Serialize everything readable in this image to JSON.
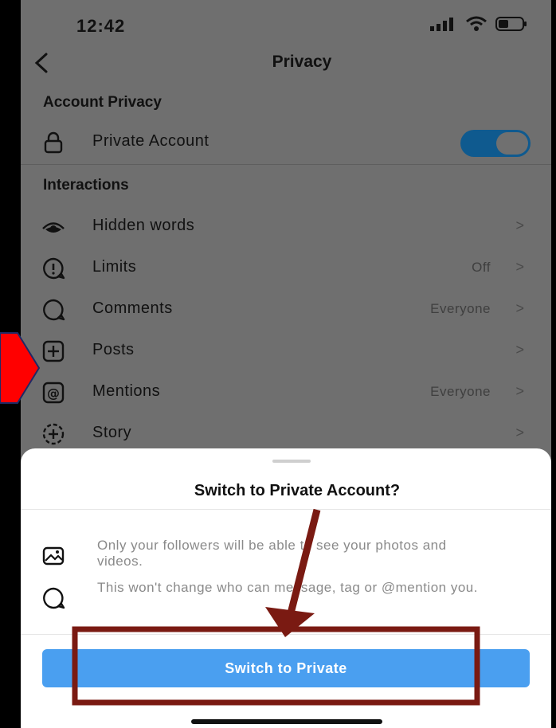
{
  "status_bar": {
    "time": "12:42"
  },
  "nav": {
    "title": "Privacy"
  },
  "account_privacy": {
    "section_title": "Account Privacy",
    "private_account_label": "Private Account",
    "private_account_on": true
  },
  "interactions": {
    "section_title": "Interactions",
    "items": [
      {
        "label": "Hidden words",
        "value": "",
        "icon": "eye-icon"
      },
      {
        "label": "Limits",
        "value": "Off",
        "icon": "limits-icon"
      },
      {
        "label": "Comments",
        "value": "Everyone",
        "icon": "comment-icon"
      },
      {
        "label": "Posts",
        "value": "",
        "icon": "plus-square-icon"
      },
      {
        "label": "Mentions",
        "value": "Everyone",
        "icon": "at-sign-icon"
      },
      {
        "label": "Story",
        "value": "",
        "icon": "story-add-icon"
      }
    ],
    "chevron": ">"
  },
  "sheet": {
    "title": "Switch to Private Account?",
    "info": [
      {
        "text": "Only your followers will be able to see your photos and videos.",
        "icon": "photo-icon"
      },
      {
        "text": "This won't change who can message, tag or @mention you.",
        "icon": "comment-icon"
      }
    ],
    "primary_button": "Switch to Private"
  },
  "colors": {
    "accent": "#4a9ff0",
    "toggle_on": "#0f5a8f",
    "annotation_red": "#ff0000",
    "annotation_brown": "#7a1a12"
  }
}
